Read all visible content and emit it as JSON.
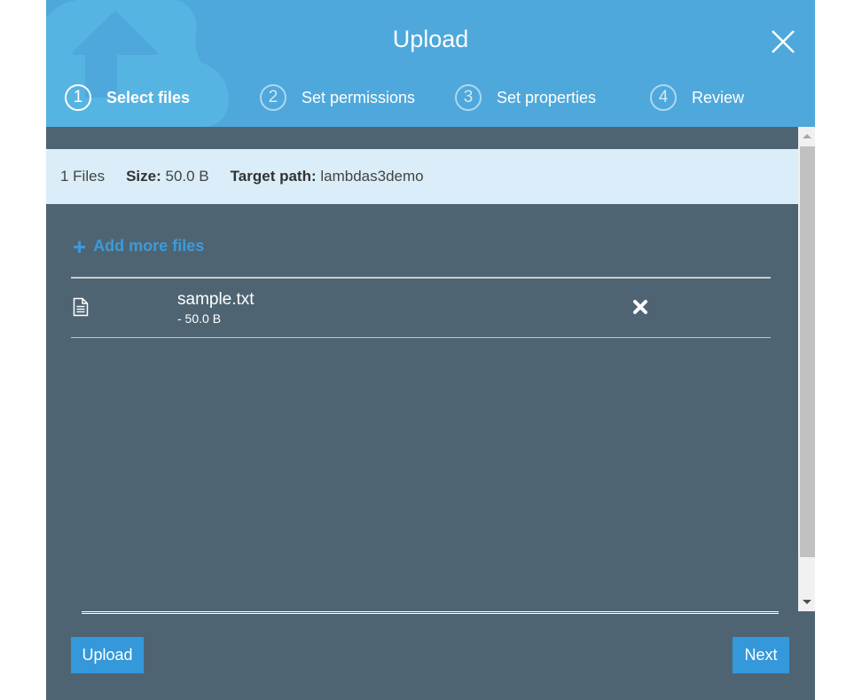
{
  "dialog": {
    "title": "Upload",
    "close_icon": "close-icon"
  },
  "colors": {
    "header": "#4ea8dc",
    "body": "#4f6472",
    "summary_bg": "#daedf8",
    "accent": "#3498db",
    "link": "#3b9bdc"
  },
  "steps": [
    {
      "number": "1",
      "label": "Select files",
      "active": true
    },
    {
      "number": "2",
      "label": "Set permissions",
      "active": false
    },
    {
      "number": "3",
      "label": "Set properties",
      "active": false
    },
    {
      "number": "4",
      "label": "Review",
      "active": false
    }
  ],
  "summary": {
    "files_count": "1 Files",
    "size_label": "Size:",
    "size_value": "50.0 B",
    "target_label": "Target path:",
    "target_value": "lambdas3demo"
  },
  "add_files": {
    "icon": "plus-icon",
    "label": "Add more files"
  },
  "files": [
    {
      "name": "sample.txt",
      "size": "- 50.0 B",
      "icon": "file-text-icon",
      "remove_icon": "remove-icon"
    }
  ],
  "footer": {
    "upload_label": "Upload",
    "next_label": "Next"
  }
}
